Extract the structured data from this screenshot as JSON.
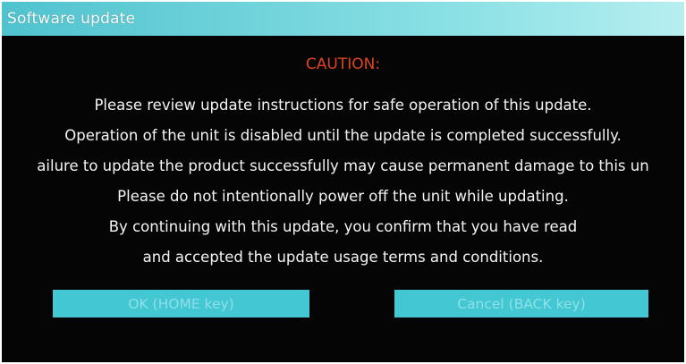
{
  "window": {
    "title": "Software update"
  },
  "dialog": {
    "heading": "CAUTION:",
    "lines": [
      "Please review update instructions for safe operation of this update.",
      "Operation of the unit is disabled until the update is completed successfully.",
      "ailure to update the product successfully may cause permanent damage to this un",
      "Please do not intentionally power off the unit while updating.",
      "By continuing with this update, you confirm that you have read",
      "and accepted the update usage terms and conditions."
    ],
    "heading_color": "#e0431f"
  },
  "buttons": {
    "ok_label": "OK (HOME key)",
    "cancel_label": "Cancel (BACK key)",
    "color": "#43c7d3"
  }
}
